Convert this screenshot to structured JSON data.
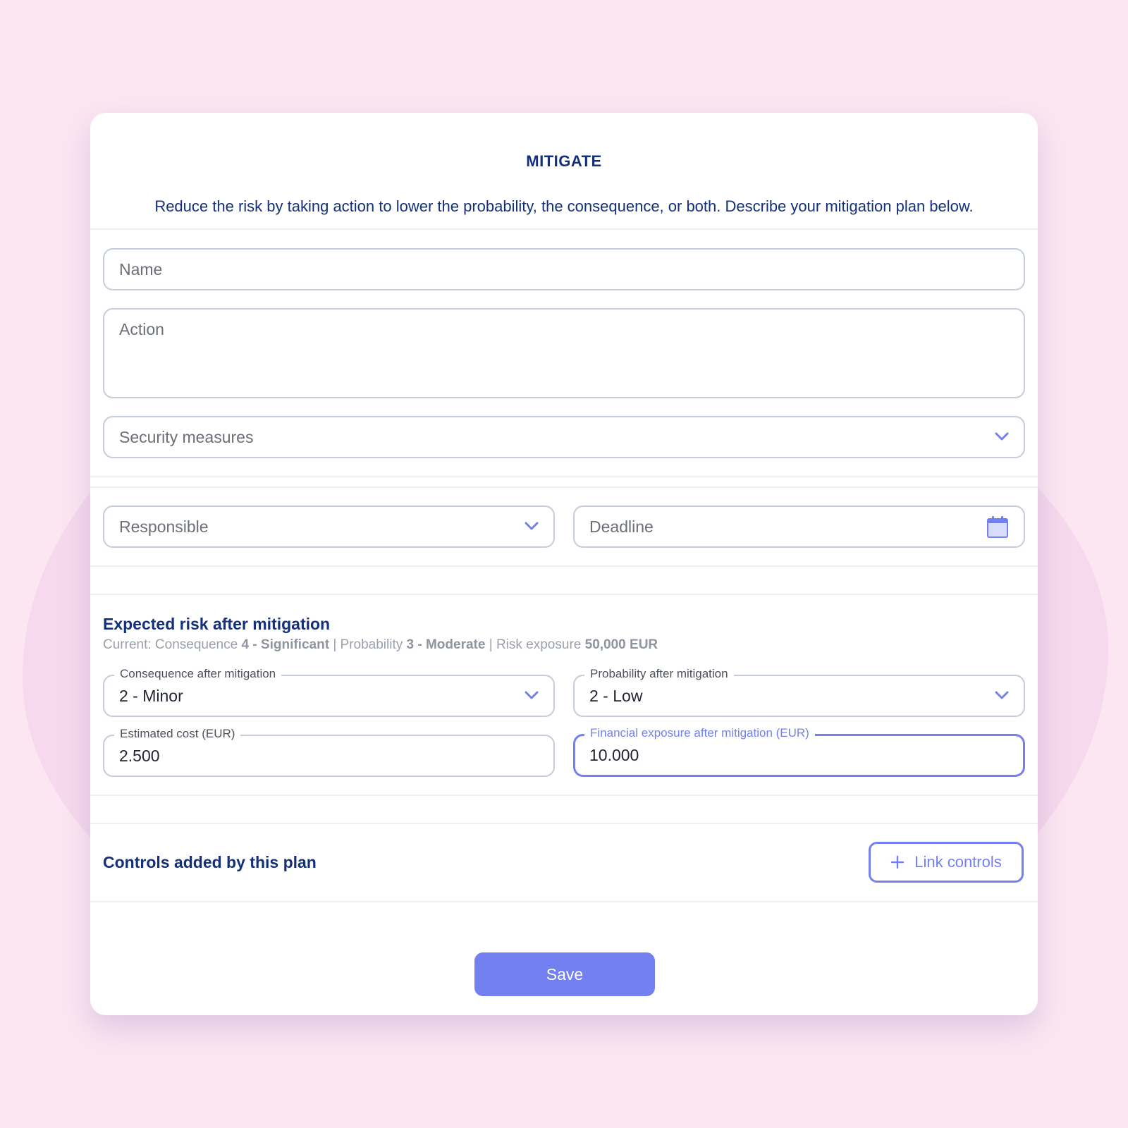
{
  "dialog": {
    "title": "MITIGATE",
    "description": "Reduce the risk by taking action to lower the probability, the consequence, or both. Describe your mitigation plan below."
  },
  "form": {
    "name_placeholder": "Name",
    "action_placeholder": "Action",
    "security_measures_placeholder": "Security measures",
    "responsible_placeholder": "Responsible",
    "deadline_placeholder": "Deadline"
  },
  "expected_risk": {
    "title": "Expected risk after mitigation",
    "current_prefix": "Current: Consequence",
    "current_consequence": "4 - Significant",
    "sep1": "|",
    "probability_prefix": "Probability",
    "current_probability": "3 - Moderate",
    "sep2": "|",
    "exposure_prefix": "Risk exposure",
    "current_exposure": "50,000 EUR",
    "consequence_label": "Consequence after mitigation",
    "consequence_value": "2 - Minor",
    "probability_label": "Probability after mitigation",
    "probability_value": "2 - Low",
    "cost_label": "Estimated cost (EUR)",
    "cost_value": "2.500",
    "exposure_label": "Financial exposure after mitigation (EUR)",
    "exposure_value": "10.000"
  },
  "controls": {
    "title": "Controls added by this plan",
    "link_label": "Link controls"
  },
  "footer": {
    "save_label": "Save"
  },
  "colors": {
    "accent": "#7380f0",
    "heading": "#14307a",
    "background": "#fbe6f1"
  },
  "icons": {
    "dropdown": "chevron-down-icon",
    "date": "calendar-icon",
    "add": "plus-icon"
  }
}
